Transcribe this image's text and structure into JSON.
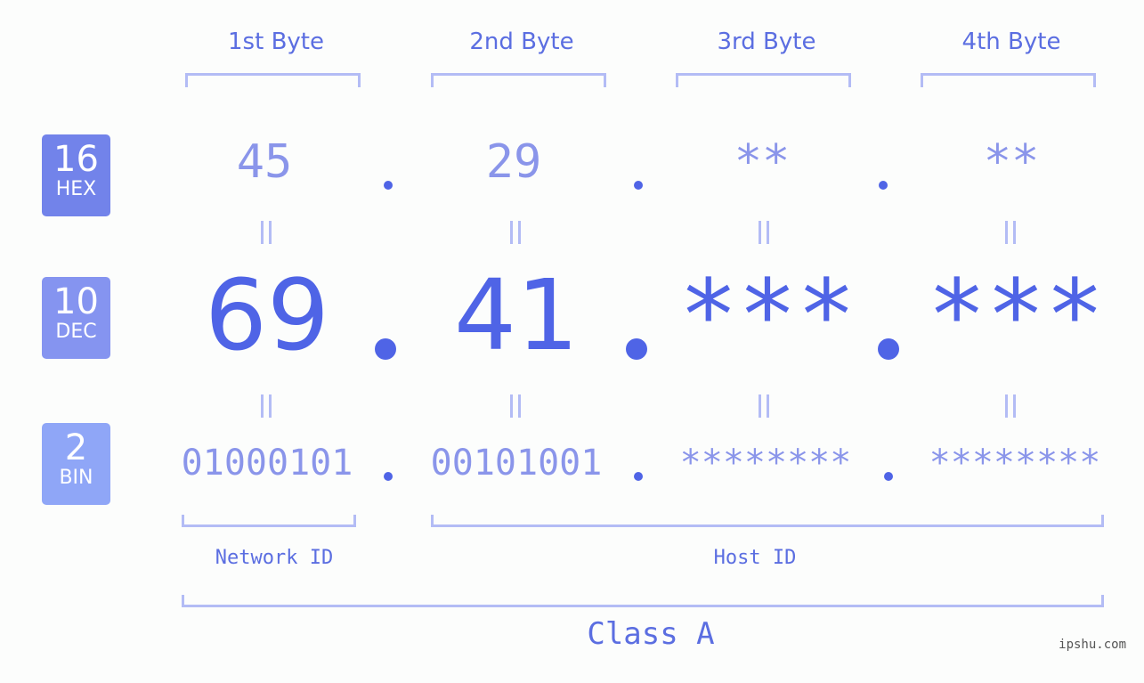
{
  "badges": [
    {
      "num": "16",
      "label": "HEX",
      "color": "#7283ea"
    },
    {
      "num": "10",
      "label": "DEC",
      "color": "#8594f0"
    },
    {
      "num": "2",
      "label": "BIN",
      "color": "#8fa6f7"
    }
  ],
  "bytes": [
    {
      "title": "1st Byte",
      "hex": "45",
      "dec": "69",
      "bin": "01000101"
    },
    {
      "title": "2nd Byte",
      "hex": "29",
      "dec": "41",
      "bin": "00101001"
    },
    {
      "title": "3rd Byte",
      "hex": "**",
      "dec": "***",
      "bin": "********"
    },
    {
      "title": "4th Byte",
      "hex": "**",
      "dec": "***",
      "bin": "********"
    }
  ],
  "labels": {
    "network_id": "Network ID",
    "host_id": "Host ID",
    "class": "Class A"
  },
  "watermark": "ipshu.com",
  "colors": {
    "accent": "#4f64e6",
    "light": "#8a95ea",
    "bracket": "#b3bcf5"
  }
}
